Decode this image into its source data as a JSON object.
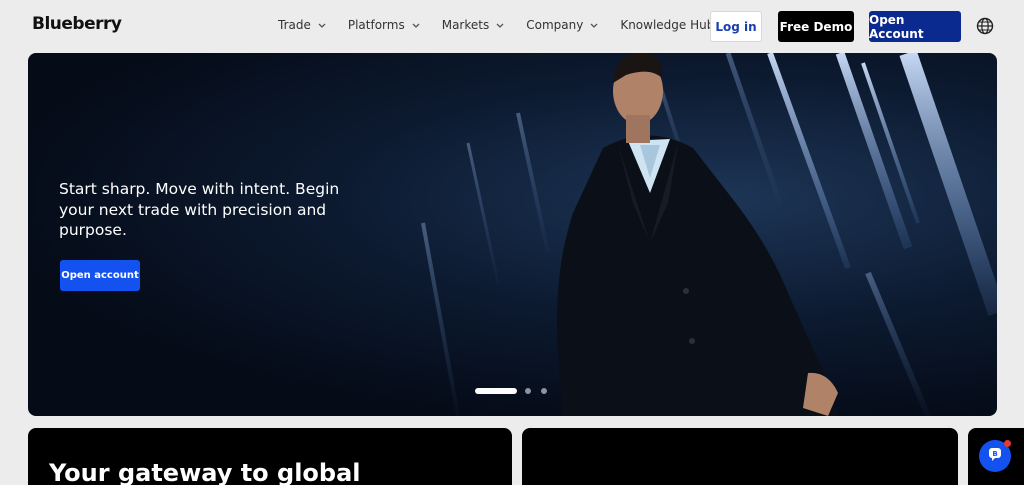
{
  "brand": {
    "logo_text": "Blueberry"
  },
  "nav": {
    "items": [
      {
        "label": "Trade"
      },
      {
        "label": "Platforms"
      },
      {
        "label": "Markets"
      },
      {
        "label": "Company"
      },
      {
        "label": "Knowledge Hub"
      }
    ],
    "login_label": "Log in",
    "demo_label": "Free Demo",
    "open_account_label": "Open Account",
    "language_icon": "globe-icon"
  },
  "hero": {
    "headline": "Start sharp. Move with intent. Begin your next trade with precision and purpose.",
    "cta_label": "Open account",
    "slides_total": 3,
    "active_slide": 1
  },
  "cards": {
    "first_title": "Your gateway to global"
  },
  "chat": {
    "icon": "chat-icon",
    "notification": true
  },
  "colors": {
    "brand_blue": "#0b2a8f",
    "cta_blue": "#1452f0",
    "hero_dark": "#050b17"
  }
}
